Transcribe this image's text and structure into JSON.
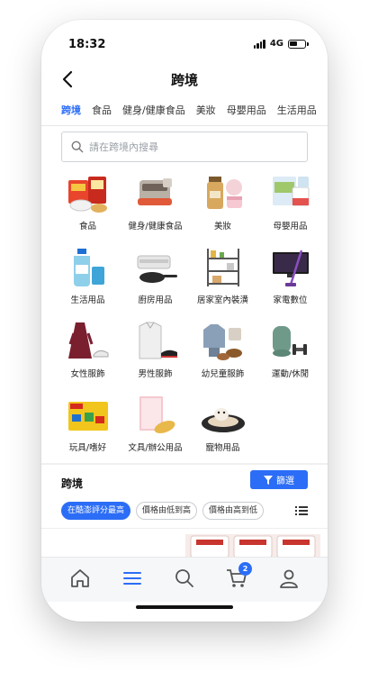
{
  "status": {
    "time": "18:32",
    "network": "4G"
  },
  "header": {
    "title": "跨境"
  },
  "tabs": [
    "跨境",
    "食品",
    "健身/健康食品",
    "美妝",
    "母嬰用品",
    "生活用品"
  ],
  "search": {
    "placeholder": "請在跨境內搜尋"
  },
  "categories": [
    {
      "label": "食品",
      "icon": "food-products-icon"
    },
    {
      "label": "健身/健康食品",
      "icon": "fitness-products-icon"
    },
    {
      "label": "美妝",
      "icon": "cosmetics-icon"
    },
    {
      "label": "母嬰用品",
      "icon": "baby-products-icon"
    },
    {
      "label": "生活用品",
      "icon": "household-products-icon"
    },
    {
      "label": "廚房用品",
      "icon": "cookware-icon"
    },
    {
      "label": "居家室內裝潢",
      "icon": "shelf-icon"
    },
    {
      "label": "家電數位",
      "icon": "tv-vacuum-icon"
    },
    {
      "label": "女性服飾",
      "icon": "dress-shoes-icon"
    },
    {
      "label": "男性服飾",
      "icon": "shirt-shoes-icon"
    },
    {
      "label": "幼兒童服飾",
      "icon": "kids-clothes-icon"
    },
    {
      "label": "運動/休閒",
      "icon": "yoga-dumbbell-icon"
    },
    {
      "label": "玩具/嗜好",
      "icon": "lego-box-icon"
    },
    {
      "label": "文具/辦公用品",
      "icon": "stationery-icon"
    },
    {
      "label": "寵物用品",
      "icon": "pet-bed-icon"
    }
  ],
  "section": {
    "title": "跨境",
    "filter_label": "篩選"
  },
  "sort_chips": [
    "在酷澎評分最高",
    "價格由低到高",
    "價格由高到低"
  ],
  "cart": {
    "count": "2"
  },
  "colors": {
    "accent": "#2b6df6"
  }
}
